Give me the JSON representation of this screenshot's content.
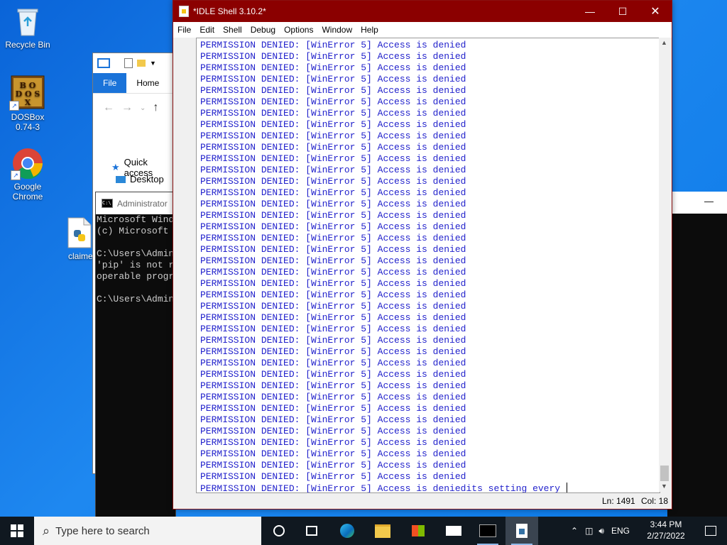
{
  "desktop": {
    "icons": [
      {
        "name": "recycle-bin",
        "label": "Recycle Bin"
      },
      {
        "name": "dosbox",
        "label_line1": "DOSBox",
        "label_line2": "0.74-3"
      },
      {
        "name": "google-chrome",
        "label_line1": "Google",
        "label_line2": "Chrome"
      },
      {
        "name": "claime-file",
        "label": "claime"
      }
    ]
  },
  "explorer": {
    "tabs": {
      "file": "File",
      "home": "Home"
    },
    "quick_access": "Quick access",
    "desktop": "Desktop"
  },
  "console": {
    "title": "Administrator",
    "lines": [
      "Microsoft Wind",
      "(c) Microsoft",
      "",
      "C:\\Users\\Admin",
      "'pip' is not r",
      "operable progr",
      "",
      "C:\\Users\\Admin"
    ]
  },
  "idle": {
    "title": "*IDLE Shell 3.10.2*",
    "menu": [
      "File",
      "Edit",
      "Shell",
      "Debug",
      "Options",
      "Window",
      "Help"
    ],
    "repeated_line": "PERMISSION DENIED: [WinError 5] Access is denied",
    "repeat_count": 39,
    "last_line": "PERMISSION DENIED: [WinError 5] Access is deniedits setting every ",
    "status": {
      "line": "Ln: 1491",
      "col": "Col: 18"
    }
  },
  "taskbar": {
    "search_placeholder": "Type here to search",
    "language": "ENG",
    "time": "3:44 PM",
    "date": "2/27/2022"
  }
}
